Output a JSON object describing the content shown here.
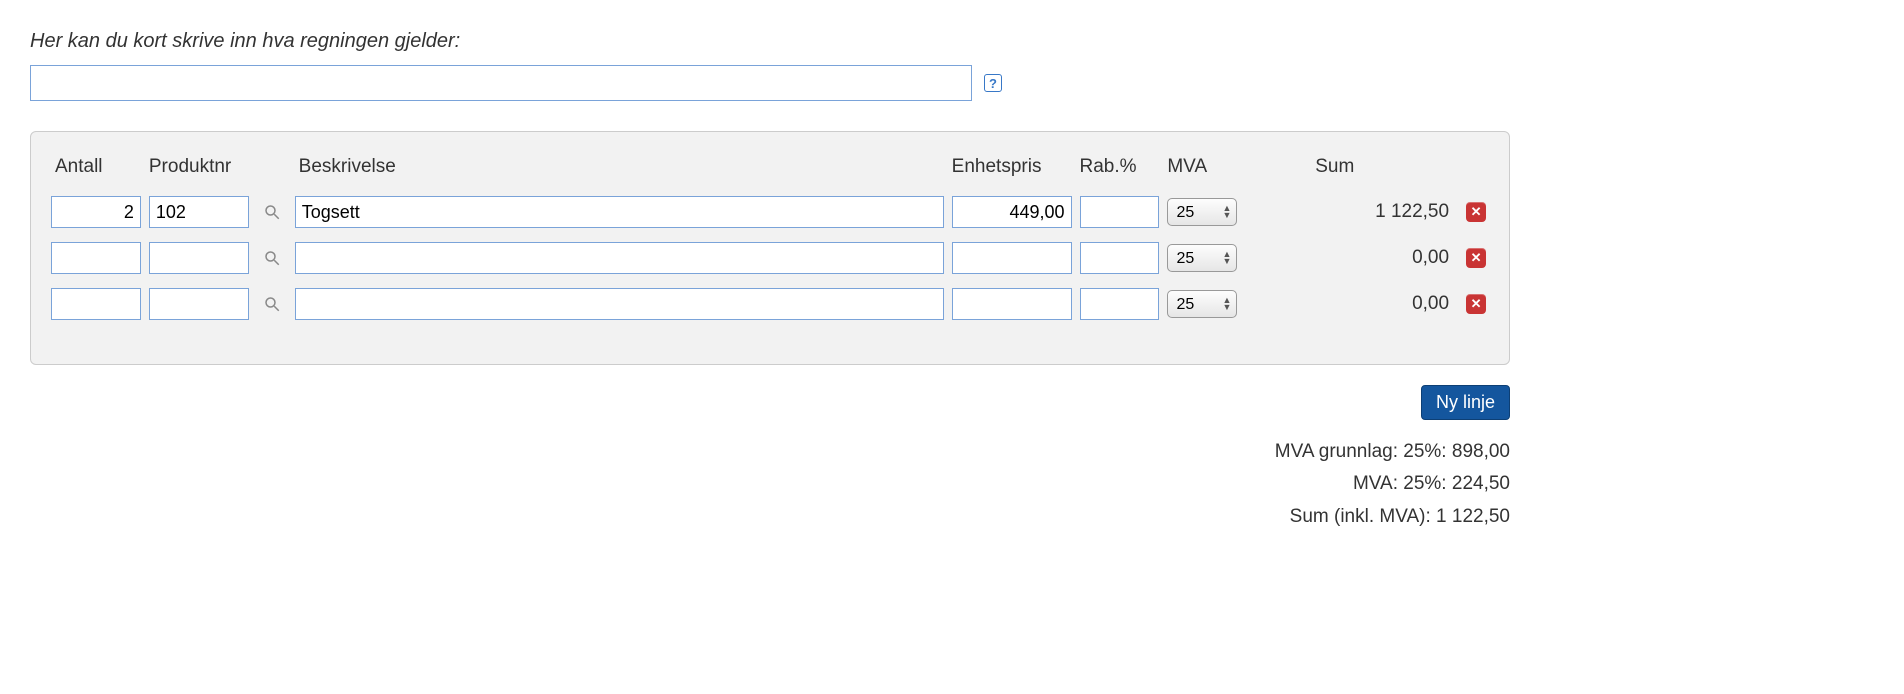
{
  "description": {
    "label": "Her kan du kort skrive inn hva regningen gjelder:",
    "value": "",
    "help_icon": "?"
  },
  "columns": {
    "antall": "Antall",
    "produktnr": "Produktnr",
    "beskrivelse": "Beskrivelse",
    "enhetspris": "Enhetspris",
    "rab": "Rab.%",
    "mva": "MVA",
    "sum": "Sum"
  },
  "mva_options": [
    "25"
  ],
  "rows": [
    {
      "antall": "2",
      "produktnr": "102",
      "beskrivelse": "Togsett",
      "enhetspris": "449,00",
      "rab": "",
      "mva": "25",
      "sum": "1 122,50"
    },
    {
      "antall": "",
      "produktnr": "",
      "beskrivelse": "",
      "enhetspris": "",
      "rab": "",
      "mva": "25",
      "sum": "0,00"
    },
    {
      "antall": "",
      "produktnr": "",
      "beskrivelse": "",
      "enhetspris": "",
      "rab": "",
      "mva": "25",
      "sum": "0,00"
    }
  ],
  "buttons": {
    "new_line": "Ny linje"
  },
  "totals": {
    "mva_grunnlag_label": "MVA grunnlag: 25%:",
    "mva_grunnlag_value": "898,00",
    "mva_label": "MVA: 25%:",
    "mva_value": "224,50",
    "sum_inkl_label": "Sum (inkl. MVA):",
    "sum_inkl_value": "1 122,50"
  }
}
